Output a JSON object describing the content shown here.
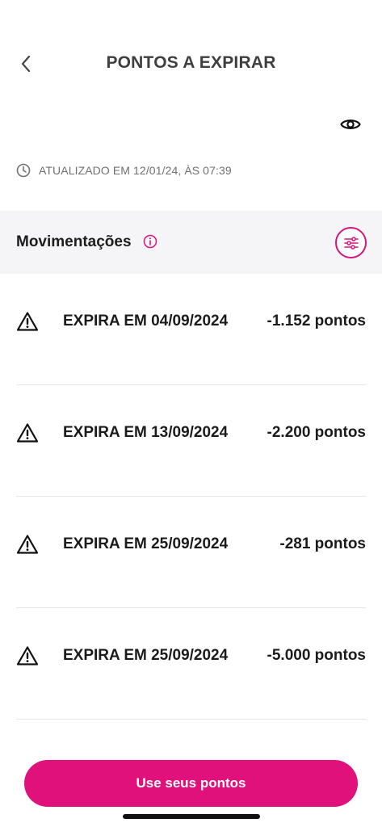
{
  "header": {
    "title": "PONTOS A EXPIRAR",
    "back_icon": "chevron-left-icon"
  },
  "visibility": {
    "icon": "eye-icon"
  },
  "updated": {
    "icon": "clock-icon",
    "text": "ATUALIZADO EM 12/01/24, ÀS 07:39"
  },
  "section": {
    "title": "Movimentações",
    "info_icon": "info-icon",
    "filter_icon": "sliders-icon"
  },
  "movements": [
    {
      "label": "EXPIRA EM 04/09/2024",
      "amount": "-1.152 pontos"
    },
    {
      "label": "EXPIRA EM 13/09/2024",
      "amount": "-2.200 pontos"
    },
    {
      "label": "EXPIRA EM 25/09/2024",
      "amount": "-281 pontos"
    },
    {
      "label": "EXPIRA EM 25/09/2024",
      "amount": "-5.000 pontos"
    }
  ],
  "cta": {
    "label": "Use seus pontos"
  },
  "colors": {
    "accent": "#e0117a",
    "section_bg": "#f5f5f7",
    "text": "#1b1b1b",
    "muted": "#707070"
  }
}
